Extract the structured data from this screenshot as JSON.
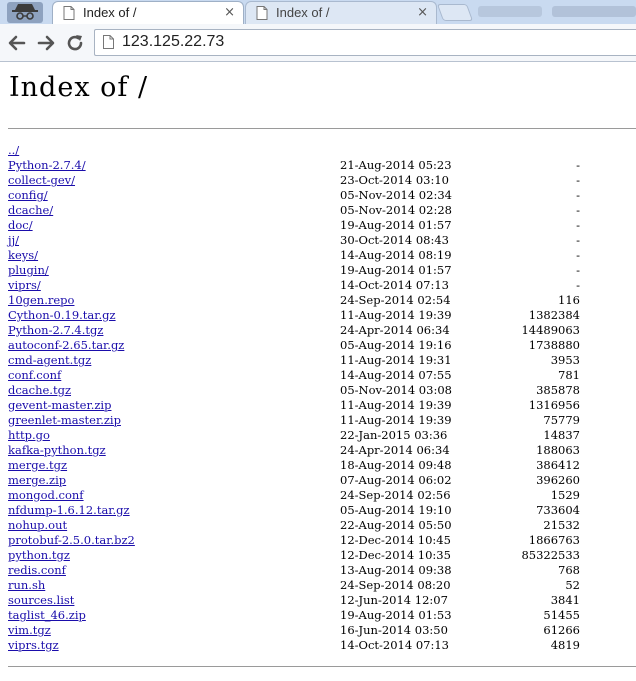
{
  "browser": {
    "tabs": [
      {
        "title": "Index of /",
        "close": "×"
      },
      {
        "title": "Index of /",
        "close": "×"
      }
    ],
    "address": "123.125.22.73"
  },
  "page": {
    "title": "Index of /",
    "entries": [
      {
        "name": "../",
        "date": "",
        "size": ""
      },
      {
        "name": "Python-2.7.4/",
        "date": "21-Aug-2014 05:23",
        "size": "-"
      },
      {
        "name": "collect-gev/",
        "date": "23-Oct-2014 03:10",
        "size": "-"
      },
      {
        "name": "config/",
        "date": "05-Nov-2014 02:34",
        "size": "-"
      },
      {
        "name": "dcache/",
        "date": "05-Nov-2014 02:28",
        "size": "-"
      },
      {
        "name": "doc/",
        "date": "19-Aug-2014 01:57",
        "size": "-"
      },
      {
        "name": "jj/",
        "date": "30-Oct-2014 08:43",
        "size": "-"
      },
      {
        "name": "keys/",
        "date": "14-Aug-2014 08:19",
        "size": "-"
      },
      {
        "name": "plugin/",
        "date": "19-Aug-2014 01:57",
        "size": "-"
      },
      {
        "name": "viprs/",
        "date": "14-Oct-2014 07:13",
        "size": "-"
      },
      {
        "name": "10gen.repo",
        "date": "24-Sep-2014 02:54",
        "size": "116"
      },
      {
        "name": "Cython-0.19.tar.gz",
        "date": "11-Aug-2014 19:39",
        "size": "1382384"
      },
      {
        "name": "Python-2.7.4.tgz",
        "date": "24-Apr-2014 06:34",
        "size": "14489063"
      },
      {
        "name": "autoconf-2.65.tar.gz",
        "date": "05-Aug-2014 19:16",
        "size": "1738880"
      },
      {
        "name": "cmd-agent.tgz",
        "date": "11-Aug-2014 19:31",
        "size": "3953"
      },
      {
        "name": "conf.conf",
        "date": "14-Aug-2014 07:55",
        "size": "781"
      },
      {
        "name": "dcache.tgz",
        "date": "05-Nov-2014 03:08",
        "size": "385878"
      },
      {
        "name": "gevent-master.zip",
        "date": "11-Aug-2014 19:39",
        "size": "1316956"
      },
      {
        "name": "greenlet-master.zip",
        "date": "11-Aug-2014 19:39",
        "size": "75779"
      },
      {
        "name": "http.go",
        "date": "22-Jan-2015 03:36",
        "size": "14837"
      },
      {
        "name": "kafka-python.tgz",
        "date": "24-Apr-2014 06:34",
        "size": "188063"
      },
      {
        "name": "merge.tgz",
        "date": "18-Aug-2014 09:48",
        "size": "386412"
      },
      {
        "name": "merge.zip",
        "date": "07-Aug-2014 06:02",
        "size": "396260"
      },
      {
        "name": "mongod.conf",
        "date": "24-Sep-2014 02:56",
        "size": "1529"
      },
      {
        "name": "nfdump-1.6.12.tar.gz",
        "date": "05-Aug-2014 19:10",
        "size": "733604"
      },
      {
        "name": "nohup.out",
        "date": "22-Aug-2014 05:50",
        "size": "21532"
      },
      {
        "name": "protobuf-2.5.0.tar.bz2",
        "date": "12-Dec-2014 10:45",
        "size": "1866763"
      },
      {
        "name": "python.tgz",
        "date": "12-Dec-2014 10:35",
        "size": "85322533"
      },
      {
        "name": "redis.conf",
        "date": "13-Aug-2014 09:38",
        "size": "768"
      },
      {
        "name": "run.sh",
        "date": "24-Sep-2014 08:20",
        "size": "52"
      },
      {
        "name": "sources.list",
        "date": "12-Jun-2014 12:07",
        "size": "3841"
      },
      {
        "name": "taglist_46.zip",
        "date": "19-Aug-2014 01:53",
        "size": "51455"
      },
      {
        "name": "vim.tgz",
        "date": "16-Jun-2014 03:50",
        "size": "61266"
      },
      {
        "name": "viprs.tgz",
        "date": "14-Oct-2014 07:13",
        "size": "4819"
      }
    ]
  },
  "icons": {
    "incognito": "incognito-icon",
    "back": "back-arrow-icon",
    "forward": "forward-arrow-icon",
    "reload": "reload-icon",
    "page": "page-icon"
  },
  "colors": {
    "link": "#1a0dab",
    "tabstrip": "#c9daf0"
  }
}
